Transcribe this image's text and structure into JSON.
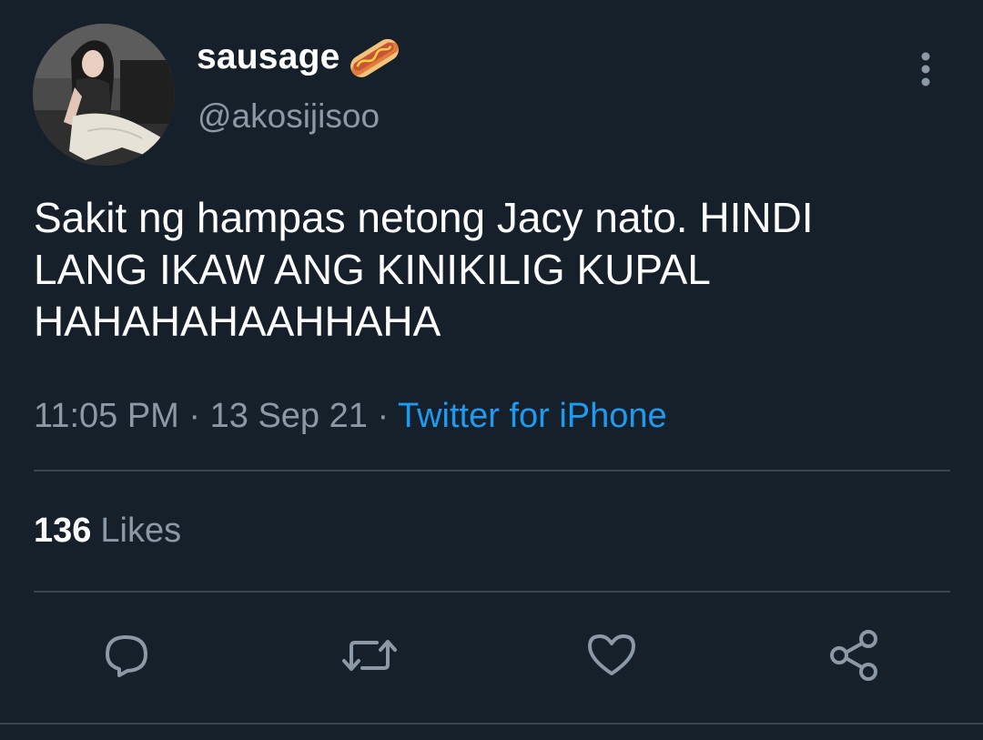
{
  "author": {
    "display_name": "sausage",
    "name_emoji_icon": "hot-dog-emoji-icon",
    "handle": "@akosijisoo",
    "avatar_icon": "profile-photo-avatar"
  },
  "tweet": {
    "text_lines": [
      "Sakit ng hampas netong Jacy nato. HINDI",
      "LANG IKAW ANG KINIKILIG KUPAL",
      "HAHAHAHAAHHAHA"
    ],
    "time": "11:05 PM",
    "separator": " · ",
    "date": "13 Sep 21",
    "source": "Twitter for iPhone"
  },
  "stats": {
    "likes_count": "136",
    "likes_label": "Likes"
  },
  "actions": [
    {
      "name": "reply",
      "icon": "speech-bubble-icon"
    },
    {
      "name": "retweet",
      "icon": "retweet-arrows-icon"
    },
    {
      "name": "like",
      "icon": "heart-icon"
    },
    {
      "name": "share",
      "icon": "share-nodes-icon"
    }
  ],
  "colors": {
    "background": "#15202b",
    "primary_text": "#ffffff",
    "secondary_text": "#8b98a5",
    "link": "#1d9bf0",
    "divider": "#38444d"
  }
}
